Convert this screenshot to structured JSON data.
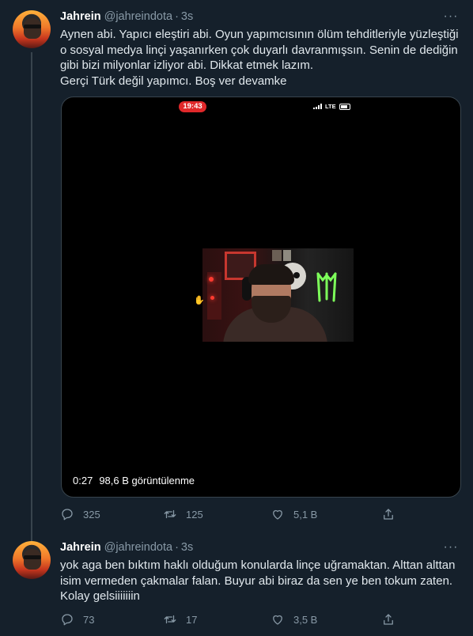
{
  "tweets": [
    {
      "name": "Jahrein",
      "handle": "@jahreindota",
      "time": "3s",
      "text_lines": [
        "Aynen abi. Yapıcı eleştiri abi. Oyun yapımcısının ölüm tehditleriyle yüzleştiği",
        "o sosyal medya linçi yaşanırken çok duyarlı davranmışsın. Senin de dediğin",
        "gibi bizi milyonlar izliyor abi. Dikkat etmek lazım.",
        "Gerçi Türk değil yapımcı. Boş ver devamke"
      ],
      "video": {
        "status_time": "19:43",
        "network": "LTE",
        "duration": "0:27",
        "views": "98,6 B görüntülenme"
      },
      "replies": "325",
      "retweets": "125",
      "likes": "5,1 B"
    },
    {
      "name": "Jahrein",
      "handle": "@jahreindota",
      "time": "3s",
      "text_lines": [
        "yok aga ben bıktım haklı olduğum konularda linçe uğramaktan. Alttan alttan",
        "isim vermeden çakmalar falan. Buyur abi biraz da sen ye ben tokum zaten.",
        "Kolay gelsiiiiiiin"
      ],
      "replies": "73",
      "retweets": "17",
      "likes": "3,5 B"
    }
  ],
  "separator": "·",
  "colors": {
    "background": "#15202b",
    "secondary_text": "#8899a6",
    "divider": "#38444d",
    "live_pill": "#e0282a"
  }
}
